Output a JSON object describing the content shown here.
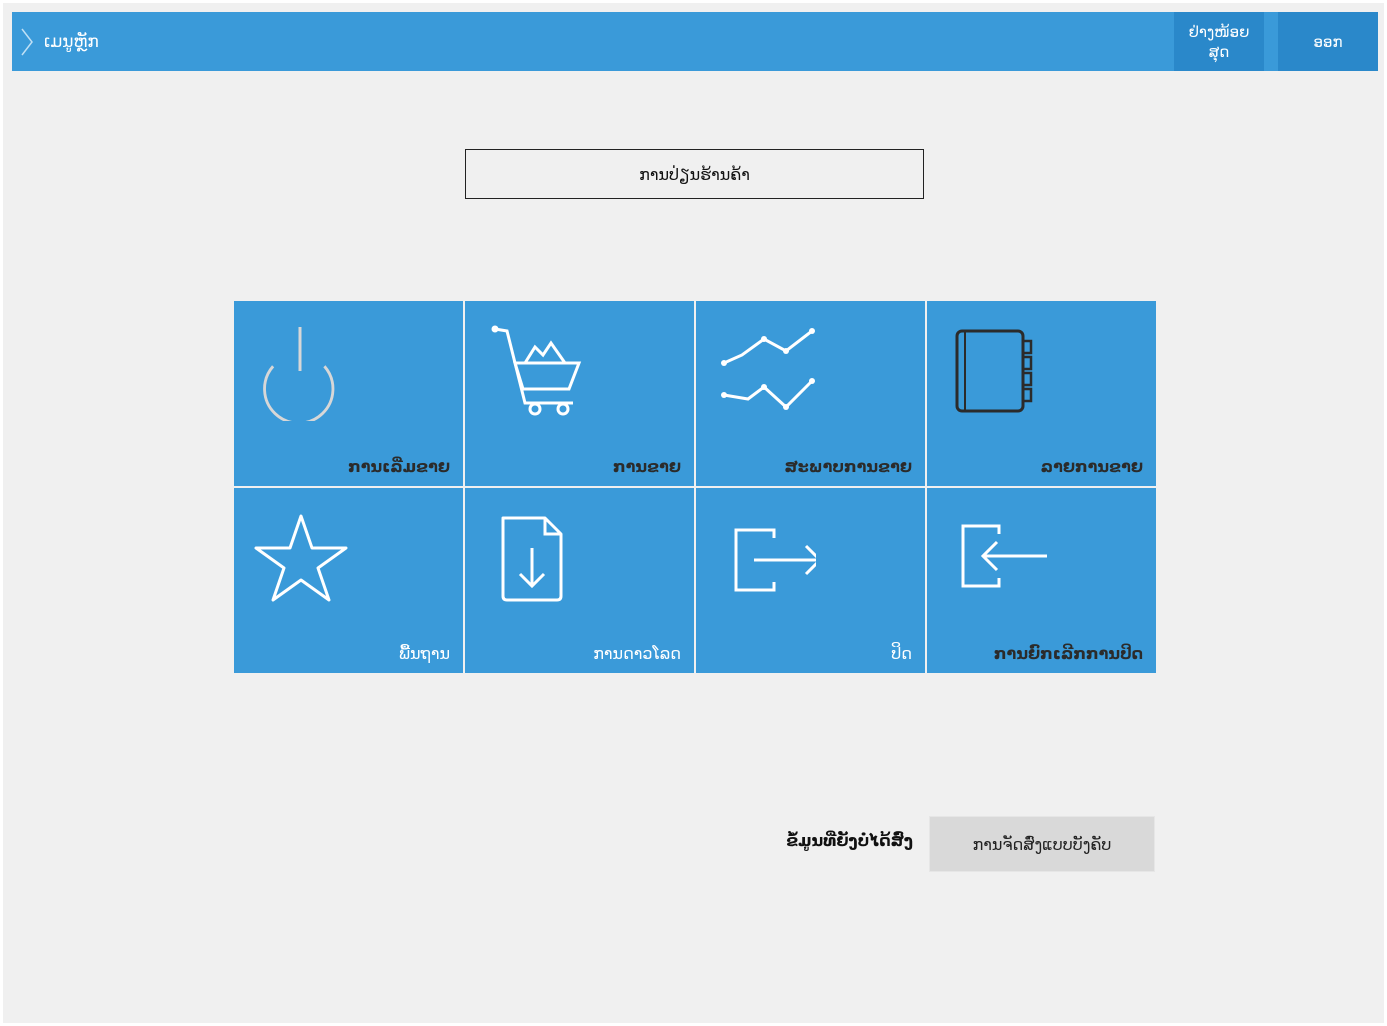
{
  "header": {
    "menu_label": "ເມນູຫຼັກ",
    "recent_label_line1": "ຢ່າງໜ້ອຍ",
    "recent_label_line2": "ສຸດ",
    "exit_label": "ອອກ"
  },
  "store": {
    "title": "ການປ່ຽນຮ້ານຄ້າ"
  },
  "tiles": [
    {
      "label": "ການເລີ່ມຂາຍ",
      "icon": "power-icon"
    },
    {
      "label": "ການຂາຍ",
      "icon": "shopping-cart-icon"
    },
    {
      "label": "ສະພາບການຂາຍ",
      "icon": "line-chart-icon"
    },
    {
      "label": "ລາຍການຂາຍ",
      "icon": "notebook-icon"
    },
    {
      "label": "ພື້ນຖານ",
      "icon": "star-icon"
    },
    {
      "label": "ການດາວໂລດ",
      "icon": "download-file-icon"
    },
    {
      "label": "ປິດ",
      "icon": "exit-icon"
    },
    {
      "label": "ການຍົກເລີກການປິດ",
      "icon": "enter-icon"
    }
  ],
  "footer": {
    "status_text": "ຂໍ້ມູນທີ່ຍັງບໍ່ໄດ້ສົ່ງ",
    "print_button_label": "ການຈັດສົ່ງແບບບັງຄັບ"
  },
  "colors": {
    "accent": "#3a9ad9",
    "header_button": "#2a88ca",
    "background": "#f0f0f0"
  }
}
